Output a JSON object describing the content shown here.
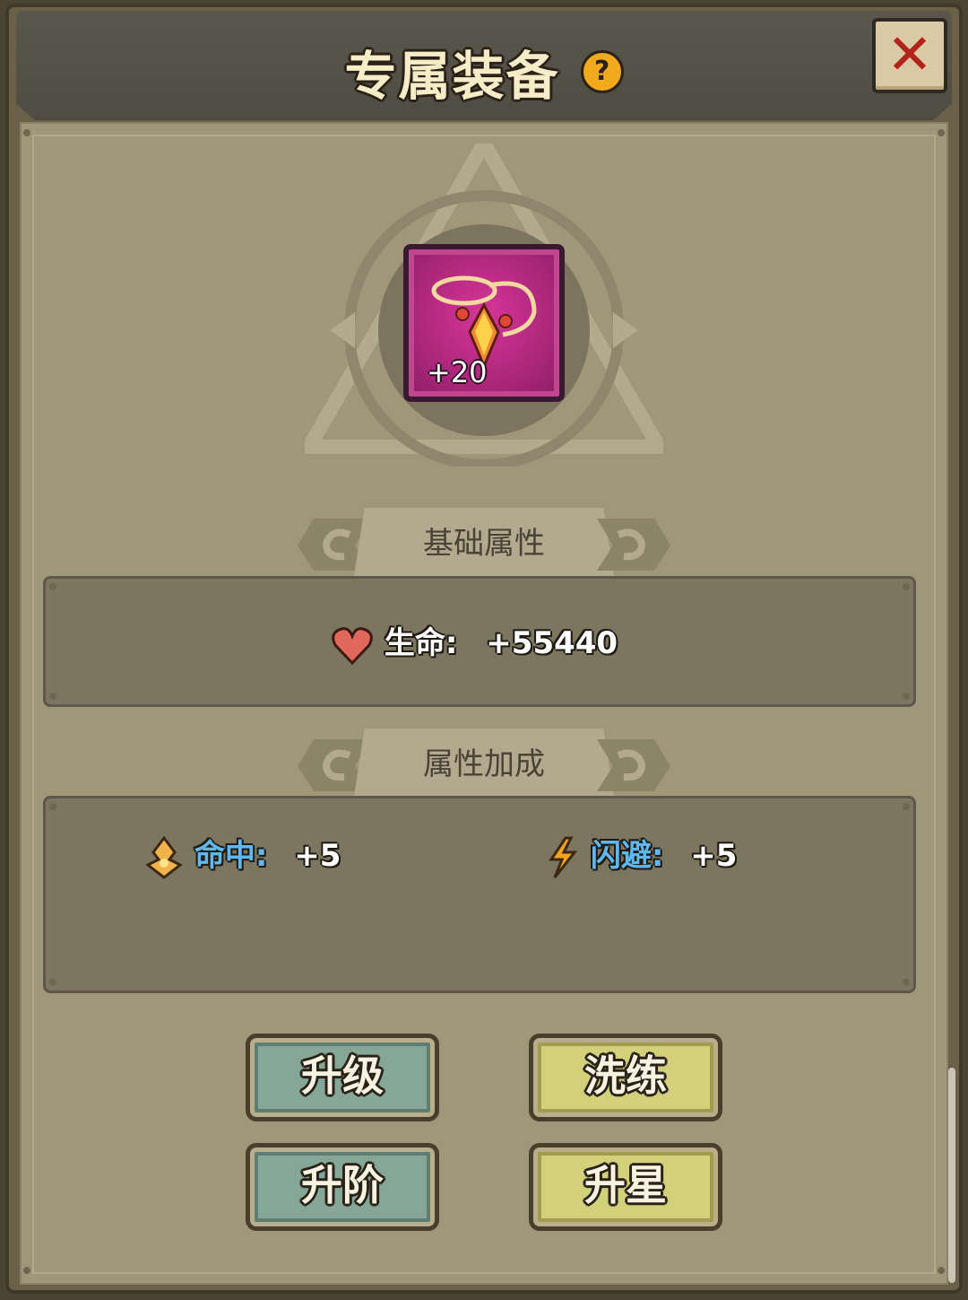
{
  "header": {
    "title": "专属装备",
    "help_label": "?",
    "close_label": "✕"
  },
  "item": {
    "level_label": "+20"
  },
  "base_section": {
    "title": "基础属性",
    "stats": [
      {
        "name": "生命:",
        "value": "+55440",
        "icon": "heart-icon",
        "name_color": "#ffffff"
      }
    ]
  },
  "bonus_section": {
    "title": "属性加成",
    "stats": [
      {
        "name": "命中:",
        "value": "+5",
        "icon": "accuracy-icon",
        "name_color": "#5fb8f0"
      },
      {
        "name": "闪避:",
        "value": "+5",
        "icon": "lightning-icon",
        "name_color": "#5fb8f0"
      }
    ]
  },
  "buttons": {
    "upgrade": "升级",
    "refine": "洗练",
    "advance": "升阶",
    "star_up": "升星"
  }
}
